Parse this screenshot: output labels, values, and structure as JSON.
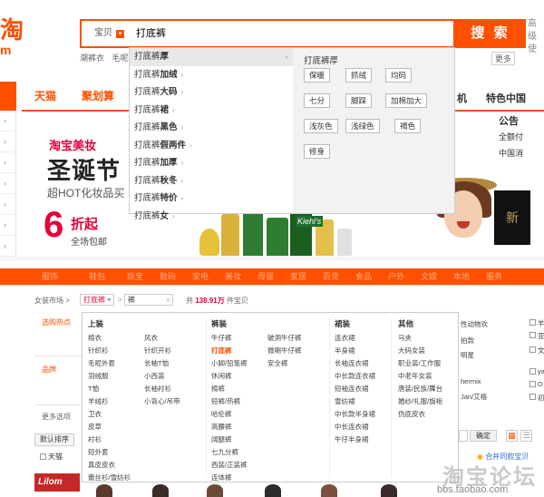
{
  "top": {
    "logo_fragment": "淘",
    "logo_m": "m",
    "search": {
      "scope_label": "宝贝",
      "scope_dropdown": "▾",
      "query": "打底裤",
      "button_label": "搜 索"
    },
    "right_fragment": [
      "高",
      "级",
      "使"
    ],
    "hot_words": [
      "潮裤衣",
      "毛呢外"
    ],
    "more_link": "更多",
    "nav": {
      "tmall": "天猫",
      "juhuasuan": "聚划算",
      "right_items": [
        "机",
        "特色中国"
      ]
    },
    "promo": {
      "shop": "淘宝美妆",
      "title": "圣诞节",
      "subtitle": "超HOT化妆品买",
      "number": "6",
      "zhe": "折起",
      "free": "全场包邮",
      "kiehls": "Kiehl's"
    },
    "gift_text": "新",
    "notice": {
      "title": "公告",
      "lines": [
        "全额付",
        "中国消"
      ]
    },
    "suggestions": [
      {
        "prefix": "打底裤",
        "suffix": "厚",
        "active": true
      },
      {
        "prefix": "打底裤",
        "suffix": "加绒",
        "active": false
      },
      {
        "prefix": "打底裤",
        "suffix": "大码",
        "active": false
      },
      {
        "prefix": "打底裤",
        "suffix": "裙",
        "active": false
      },
      {
        "prefix": "打底裤",
        "suffix": "黑色",
        "active": false
      },
      {
        "prefix": "打底裤",
        "suffix": "假两件",
        "active": false
      },
      {
        "prefix": "打底裤",
        "suffix": "加厚",
        "active": false
      },
      {
        "prefix": "打底裤",
        "suffix": "秋冬",
        "active": false
      },
      {
        "prefix": "打底裤",
        "suffix": "特价",
        "active": false
      },
      {
        "prefix": "打底裤",
        "suffix": "女",
        "active": false
      }
    ],
    "panel": {
      "title": "打底裤厚",
      "tags": [
        "保暖",
        "抓绒",
        "均码",
        "七分",
        "脚踩",
        "加棉加大",
        "浅灰色",
        "浅绿色",
        "褐色",
        "修身"
      ]
    }
  },
  "bottom": {
    "cat_strip": [
      "服饰",
      "鞋包",
      "珠宝",
      "数码",
      "家电",
      "美妆",
      "母婴",
      "家居",
      "百货",
      "食品",
      "户外",
      "文娱",
      "本地",
      "服务"
    ],
    "crumb": {
      "market": "女装市场",
      "sep": ">",
      "category": "打底裤",
      "category_dd": "▾",
      "sep2": ">",
      "query": "裤",
      "count_prefix": "共",
      "count": "138.91万",
      "count_suffix": "件宝贝"
    },
    "left": {
      "hot": "选购热点",
      "brand": "品牌",
      "more_options": "更多选项",
      "sort": "默认排序",
      "tmall": "天猫",
      "ad": "Lilom"
    },
    "menu": {
      "cols": [
        {
          "head": "上装",
          "items": [
            "棉衣",
            "针织衫",
            "毛呢外套",
            "羽绒服",
            "T恤",
            "羊绒衫",
            "卫衣",
            "皮草",
            "衬衫",
            "短外套",
            "真皮皮衣",
            "蕾丝衫/雪纺衫"
          ]
        },
        {
          "head": "",
          "items": [
            "风衣",
            "针织开衫",
            "长袖T恤",
            "小西装",
            "长袖衬衫",
            "小背心/吊带"
          ]
        },
        {
          "head": "裤装",
          "items": [
            "牛仔裤",
            "打底裤",
            "小脚/铅笔裤",
            "休闲裤",
            "棉裤",
            "短裤/热裤",
            "哈伦裤",
            "高腰裤",
            "阔腿裤",
            "七九分裤",
            "西装/正装裤",
            "连体裤"
          ],
          "highlight": 1
        },
        {
          "head": "",
          "items": [
            "破洞牛仔裤",
            "微喇牛仔裤",
            "安全裤"
          ]
        },
        {
          "head": "裙装",
          "items": [
            "连衣裙",
            "半身裙",
            "长袖连衣裙",
            "中长款连衣裙",
            "短袖连衣裙",
            "雪纺裙",
            "中长款半身裙",
            "中长连衣裙",
            "牛仔半身裙"
          ]
        },
        {
          "head": "其他",
          "items": [
            "马夹",
            "大码女装",
            "职业装/工作服",
            "中老年女装",
            "唐装/民族/舞台",
            "婚纱/礼服/旗袍",
            "伪底皮衣"
          ]
        }
      ]
    },
    "right": {
      "items": [
        "性动物欢",
        "拍款",
        "明星",
        "hermix",
        "Jan/艾格"
      ],
      "checks": [
        "羊",
        "亚",
        "文",
        "ya",
        "O",
        "初"
      ],
      "confirm": "确定",
      "grid_icon": "▦",
      "list_icon": "☰",
      "merge": "合并同款宝贝",
      "merge_icon": "◉"
    },
    "watermark": {
      "big": "淘宝论坛",
      "url": "bbs.taobao.com"
    }
  }
}
